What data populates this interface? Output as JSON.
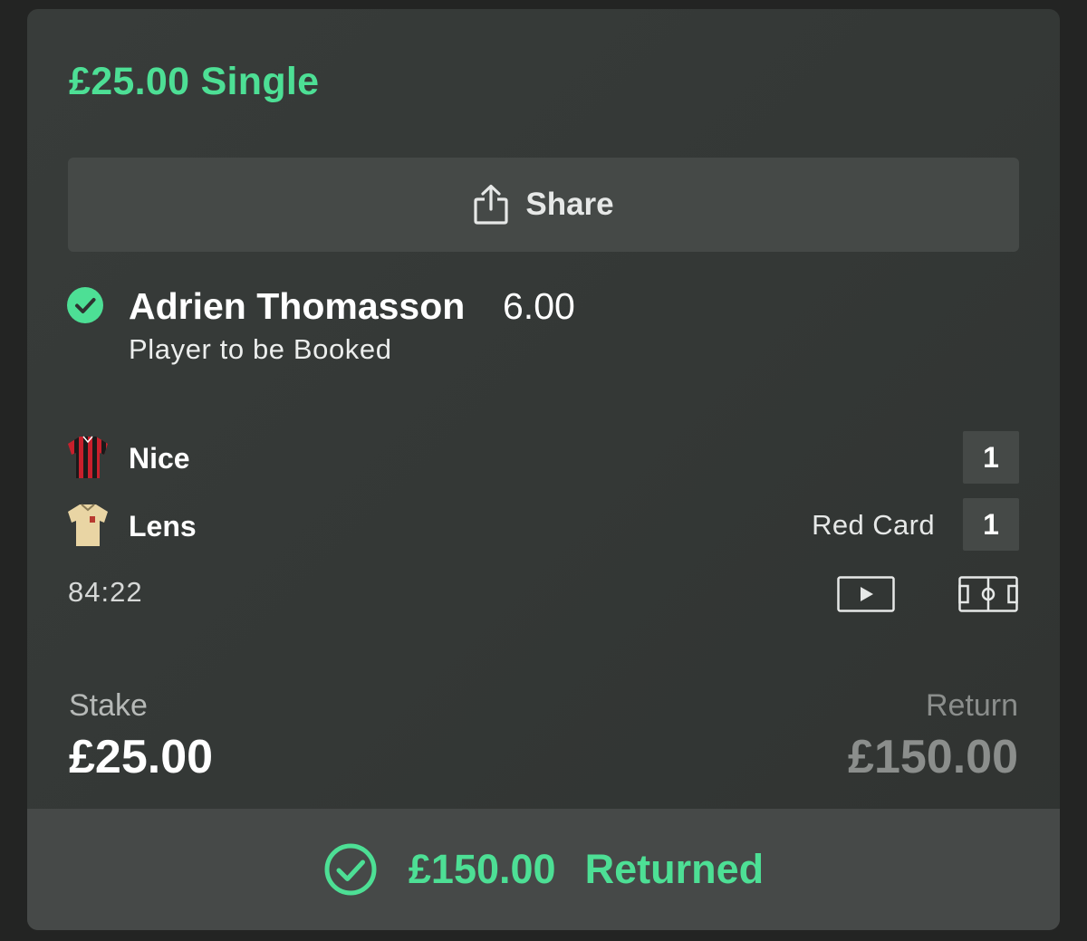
{
  "bet": {
    "title": "£25.00 Single",
    "share_label": "Share",
    "selection": "Adrien Thomasson",
    "odds": "6.00",
    "market": "Player to be Booked"
  },
  "match": {
    "home": {
      "name": "Nice",
      "score": "1",
      "kit_icon": "red-black-striped-shirt-icon",
      "kit_colors": [
        "#c8202c",
        "#1a1a1a"
      ]
    },
    "away": {
      "name": "Lens",
      "score": "1",
      "event": "Red Card",
      "kit_icon": "cream-shirt-icon",
      "kit_colors": [
        "#e9d5a4",
        "#b8392f"
      ]
    },
    "clock": "84:22"
  },
  "stake": {
    "label": "Stake",
    "value": "£25.00"
  },
  "return": {
    "label": "Return",
    "value": "£150.00"
  },
  "footer": {
    "amount": "£150.00",
    "status": "Returned"
  },
  "colors": {
    "accent_green": "#4ddf95",
    "card_bg": "#363a38",
    "button_bg": "#454947"
  }
}
